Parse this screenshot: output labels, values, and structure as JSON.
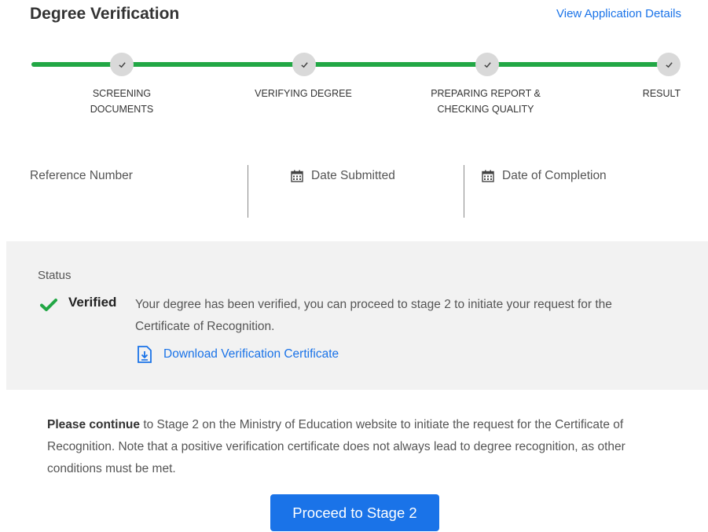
{
  "header": {
    "title": "Degree Verification",
    "details_link": "View Application Details"
  },
  "progress": {
    "accent_color": "#22a745",
    "steps": [
      {
        "line1": "SCREENING",
        "line2": "DOCUMENTS",
        "state": "complete"
      },
      {
        "line1": "VERIFYING DEGREE",
        "line2": "",
        "state": "complete"
      },
      {
        "line1": "PREPARING REPORT &",
        "line2": "CHECKING QUALITY",
        "state": "complete"
      },
      {
        "line1": "RESULT",
        "line2": "",
        "state": "complete"
      }
    ]
  },
  "info": {
    "reference_label": "Reference Number",
    "date_submitted_label": "Date Submitted",
    "date_completion_label": "Date of Completion",
    "calendar_icon": "calendar-icon"
  },
  "status": {
    "heading": "Status",
    "state": "Verified",
    "message": "Your degree has been verified, you can proceed to stage 2 to initiate your request for the Certificate of Recognition.",
    "download_label": "Download Verification Certificate",
    "check_color": "#22a745"
  },
  "note": {
    "bold": "Please continue",
    "text": " to Stage 2 on the Ministry of Education website to initiate the request for the Certificate of Recognition. Note that a positive verification certificate does not always lead to degree recognition, as other conditions must be met."
  },
  "actions": {
    "proceed_label": "Proceed to Stage 2",
    "button_color": "#1a73e8"
  }
}
